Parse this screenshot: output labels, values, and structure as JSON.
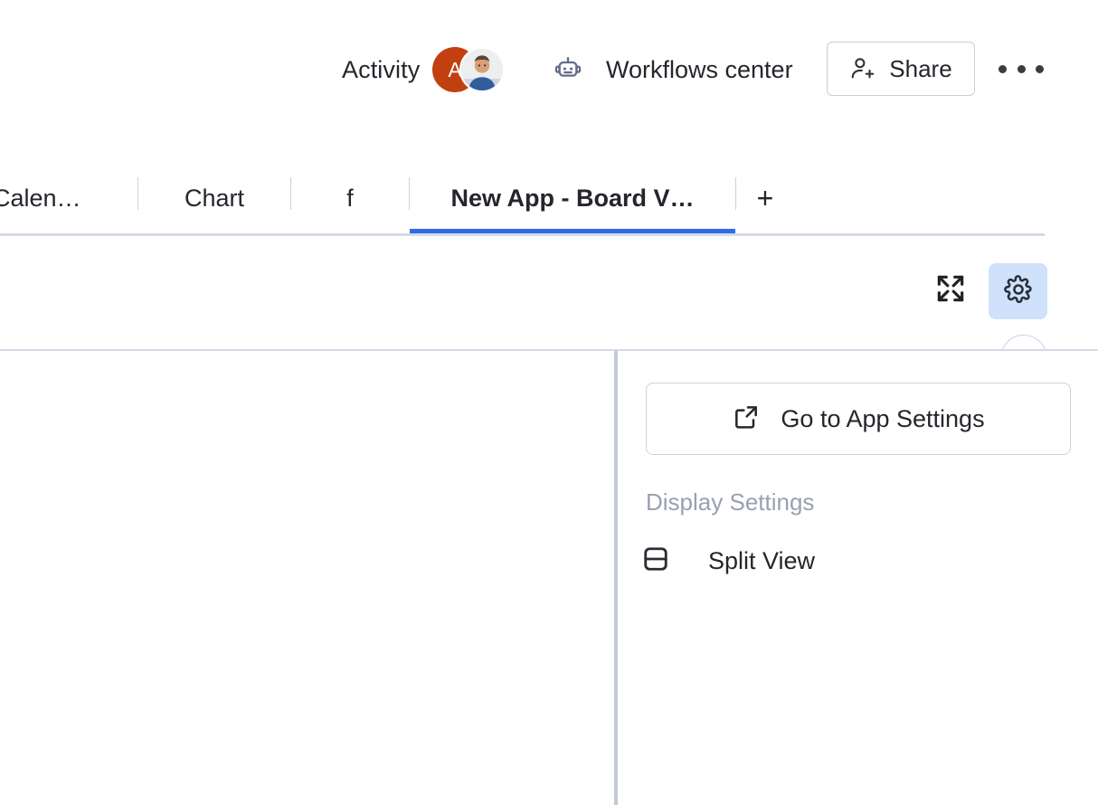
{
  "topbar": {
    "activity_label": "Activity",
    "avatars": [
      {
        "name": "avatar-initial",
        "initial": "A",
        "color": "#c2400f"
      },
      {
        "name": "avatar-photo",
        "initial": "",
        "color": "#e9eaec"
      }
    ],
    "workflows_label": "Workflows center",
    "workflows_icon": "robot-icon",
    "share_label": "Share",
    "share_icon": "person-plus-icon",
    "more_icon": "more-horizontal-icon"
  },
  "tabbar": {
    "tabs": [
      {
        "label": "Calen…",
        "active": false
      },
      {
        "label": "Chart",
        "active": false
      },
      {
        "label": "f",
        "active": false
      },
      {
        "label": "New App - Board V…",
        "active": true
      }
    ],
    "add_tab_label": "+",
    "collapse_icon": "chevron-up-icon",
    "active_underline_color": "#2f6ce5",
    "border_color": "#d6dae6"
  },
  "toolbar": {
    "expand_icon": "expand-arrows-icon",
    "settings_icon": "gear-icon",
    "settings_active": true,
    "settings_active_bg": "#cfe1fb"
  },
  "settings_panel": {
    "goto_app_settings_label": "Go to App Settings",
    "goto_app_settings_icon": "external-link-icon",
    "display_settings_label": "Display Settings",
    "split_view_label": "Split View",
    "split_view_icon": "split-horizontal-icon"
  }
}
